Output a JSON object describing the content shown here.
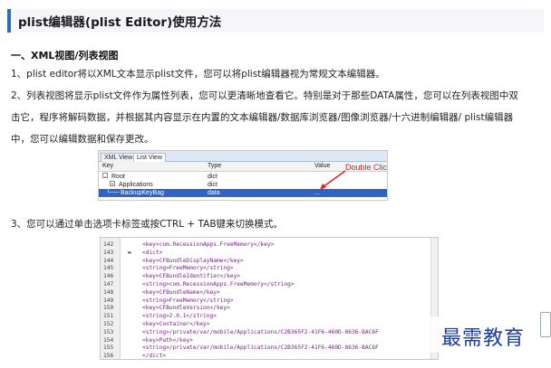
{
  "title": "plist编辑器(plist Editor)使用方法",
  "section1": {
    "heading": "一、XML视图/列表视图"
  },
  "paragraphs": [
    "1、plist editor将以XML文本显示plist文件，您可以将plist编辑器视为常规文本编辑器。",
    "2、列表视图将显示plist文件作为属性列表，您可以更清晰地查看它。特别是对于那些DATA属性，您可以在列表视图中双",
    "击它，程序将解码数据，并根据其内容显示在内置的文本编辑器/数据库浏览器/图像浏览器/十六进制编辑器/ plist编辑器",
    "中，您可以编辑数据和保存更改。",
    "3、您可以通过单击选项卡标签或按CTRL + TAB键来切换模式。"
  ],
  "list_view_screenshot": {
    "tabs": [
      "XML View",
      "List View"
    ],
    "active_tab": 1,
    "columns": [
      "Key",
      "Type",
      "Value"
    ],
    "rows": [
      {
        "key": "Root",
        "type": "dict",
        "value": "",
        "expander": "-"
      },
      {
        "key": "Applications",
        "type": "dict",
        "value": "",
        "expander": "+"
      },
      {
        "key": "BackupKeyBag",
        "type": "data",
        "value": "...",
        "selected": true
      }
    ],
    "annotation": "Double Click Here",
    "annotation_color": "#e0201f",
    "selection_color": "#2f63c4"
  },
  "xml_view_screenshot": {
    "lines": [
      {
        "num": "142",
        "fold": "",
        "code": "<key>com.RecessionApps.FreeMemory</key>"
      },
      {
        "num": "143",
        "fold": "▬",
        "code": "<dict>"
      },
      {
        "num": "144",
        "fold": "",
        "code": "  <key>CFBundleDisplayName</key>"
      },
      {
        "num": "145",
        "fold": "",
        "code": "  <string>FreeMemory</string>"
      },
      {
        "num": "146",
        "fold": "",
        "code": "  <key>CFBundleIdentifier</key>"
      },
      {
        "num": "147",
        "fold": "",
        "code": "  <string>com.RecessionApps.FreeMemory</string>"
      },
      {
        "num": "148",
        "fold": "",
        "code": "  <key>CFBundleName</key>"
      },
      {
        "num": "149",
        "fold": "",
        "code": "  <string>FreeMemory</string>"
      },
      {
        "num": "150",
        "fold": "",
        "code": "  <key>CFBundleVersion</key>"
      },
      {
        "num": "151",
        "fold": "",
        "code": "  <string>2.0.1</string>"
      },
      {
        "num": "152",
        "fold": "",
        "code": "  <key>Container</key>"
      },
      {
        "num": "153",
        "fold": "",
        "code": "  <string>/private/var/mobile/Applications/C2B365F2-41F6-460D-8636-BAC6F"
      },
      {
        "num": "154",
        "fold": "",
        "code": "  <key>Path</key>"
      },
      {
        "num": "155",
        "fold": "",
        "code": "  <string>/private/var/mobile/Applications/C2B365F2-41F6-460D-8636-BAC6F"
      },
      {
        "num": "156",
        "fold": "",
        "code": "</dict>"
      }
    ]
  },
  "watermark": "最需教育",
  "colors": {
    "accent": "#2c6fbd",
    "watermark": "#1c3e9a"
  }
}
